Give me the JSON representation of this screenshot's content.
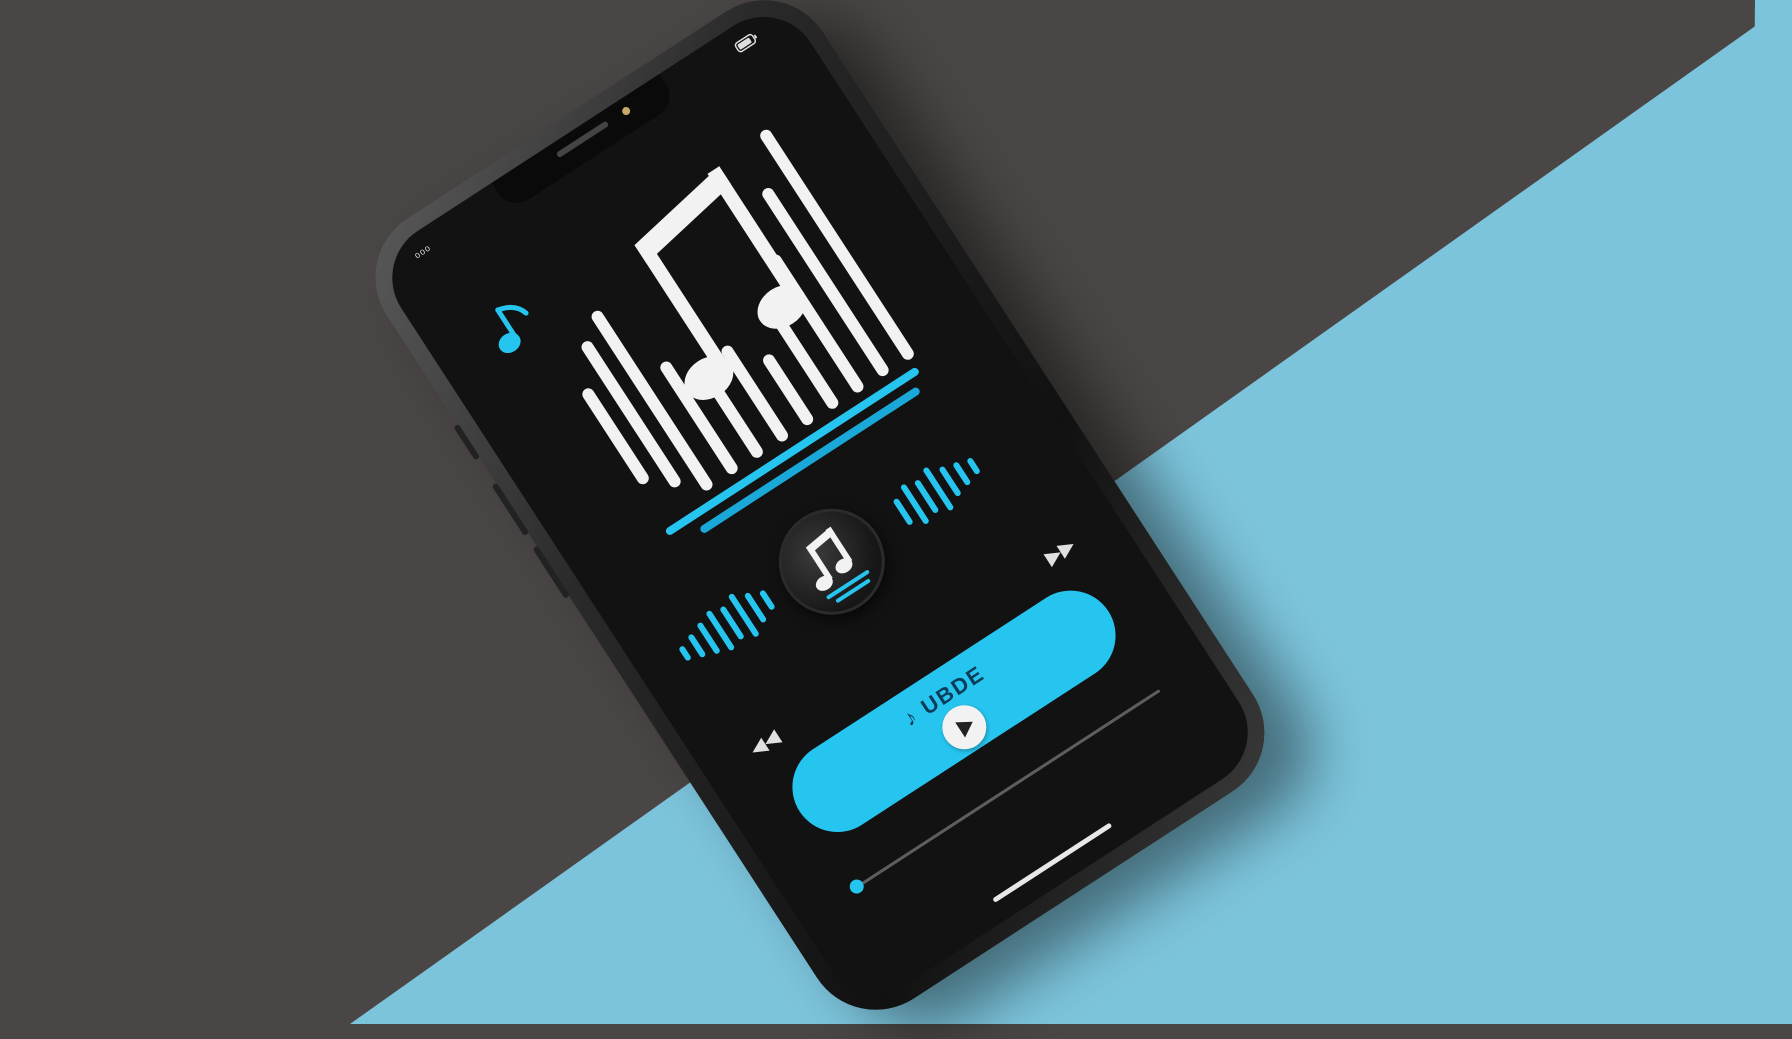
{
  "colors": {
    "accent": "#26c5f0",
    "screen": "#121212",
    "surface_dark": "#4a4645",
    "surface_blue": "#7cc4dc",
    "icon_white": "#f2f2f2"
  },
  "status_bar": {
    "left_text": "ᵒᵒᵒ",
    "right_icon": "battery-icon"
  },
  "artwork": {
    "icon": "music-note-icon",
    "small_icon": "small-music-note-icon"
  },
  "player": {
    "track_label": "♪ UBDE",
    "play_icon": "play-icon",
    "prev_icon": "previous-icon",
    "next_icon": "next-icon",
    "progress": 0.02
  }
}
